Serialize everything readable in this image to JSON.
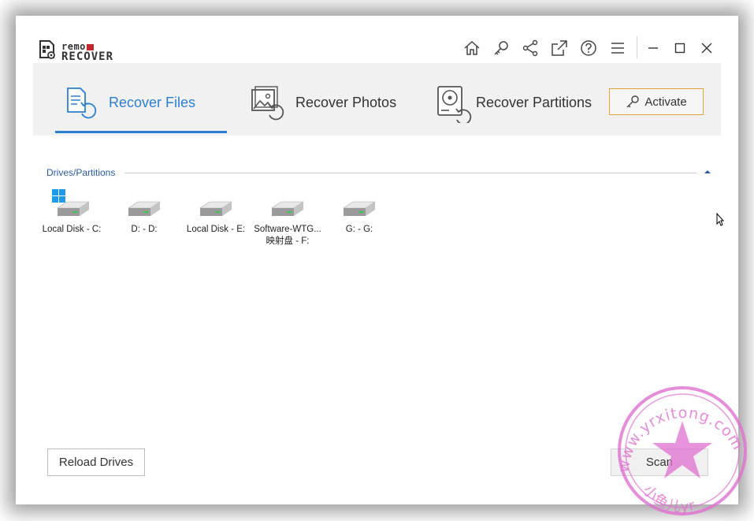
{
  "app": {
    "logo_top": "remo",
    "logo_bottom": "RECOVER"
  },
  "titlebar": {
    "icons": [
      "home-icon",
      "key-icon",
      "share-icon",
      "external-link-icon",
      "help-icon",
      "menu-icon",
      "minimize-icon",
      "maximize-icon",
      "close-icon"
    ]
  },
  "tabs": [
    {
      "label": "Recover Files",
      "active": true
    },
    {
      "label": "Recover Photos",
      "active": false
    },
    {
      "label": "Recover Partitions",
      "active": false
    }
  ],
  "activate_label": "Activate",
  "drives_section": {
    "title": "Drives/Partitions",
    "drives": [
      {
        "line1": "Local Disk - C:",
        "line2": "",
        "system": true
      },
      {
        "line1": "D: - D:",
        "line2": "",
        "system": false
      },
      {
        "line1": "Local Disk - E:",
        "line2": "",
        "system": false
      },
      {
        "line1": "Software-WTG...",
        "line2": "映射盘 - F:",
        "system": false
      },
      {
        "line1": "G: - G:",
        "line2": "",
        "system": false
      }
    ]
  },
  "buttons": {
    "reload": "Reload Drives",
    "scan": "Scan"
  },
  "colors": {
    "accent": "#2b7fd0",
    "activate_border": "#e0a43a",
    "tab_band": "#f1f1f1",
    "watermark": "#e070d0"
  },
  "watermark": {
    "top_text": "www.yrxitong.com",
    "bottom_text": "小鱼儿yr"
  }
}
